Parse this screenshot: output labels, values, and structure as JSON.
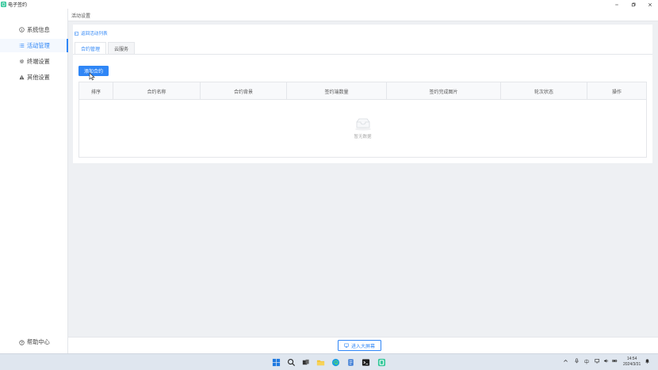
{
  "window": {
    "title": "电子签约"
  },
  "sidebar": {
    "items": [
      {
        "label": "系统信息",
        "icon": "info-circle-icon",
        "active": false
      },
      {
        "label": "活动管理",
        "icon": "list-icon",
        "active": true
      },
      {
        "label": "终端设置",
        "icon": "gear-icon",
        "active": false
      },
      {
        "label": "其他设置",
        "icon": "warning-icon",
        "active": false
      }
    ],
    "help_label": "帮助中心"
  },
  "header": {
    "title": "活动设置"
  },
  "content": {
    "back_label": "返回活动列表",
    "tabs": [
      {
        "label": "合约管理",
        "active": true
      },
      {
        "label": "云服务",
        "active": false
      }
    ],
    "add_button_label": "添加合约",
    "table": {
      "columns": [
        "排序",
        "合约名称",
        "合约背景",
        "签约端数量",
        "签约完成图片",
        "轮次状态",
        "操作"
      ],
      "rows": [],
      "empty_text": "暂无数据"
    }
  },
  "footer": {
    "big_screen_label": "进入大屏幕"
  },
  "taskbar": {
    "tray_lang": "中",
    "time": "14:54",
    "date": "2024/3/31"
  },
  "colors": {
    "accent": "#2f86f6",
    "app_logo": "#34c79a"
  }
}
